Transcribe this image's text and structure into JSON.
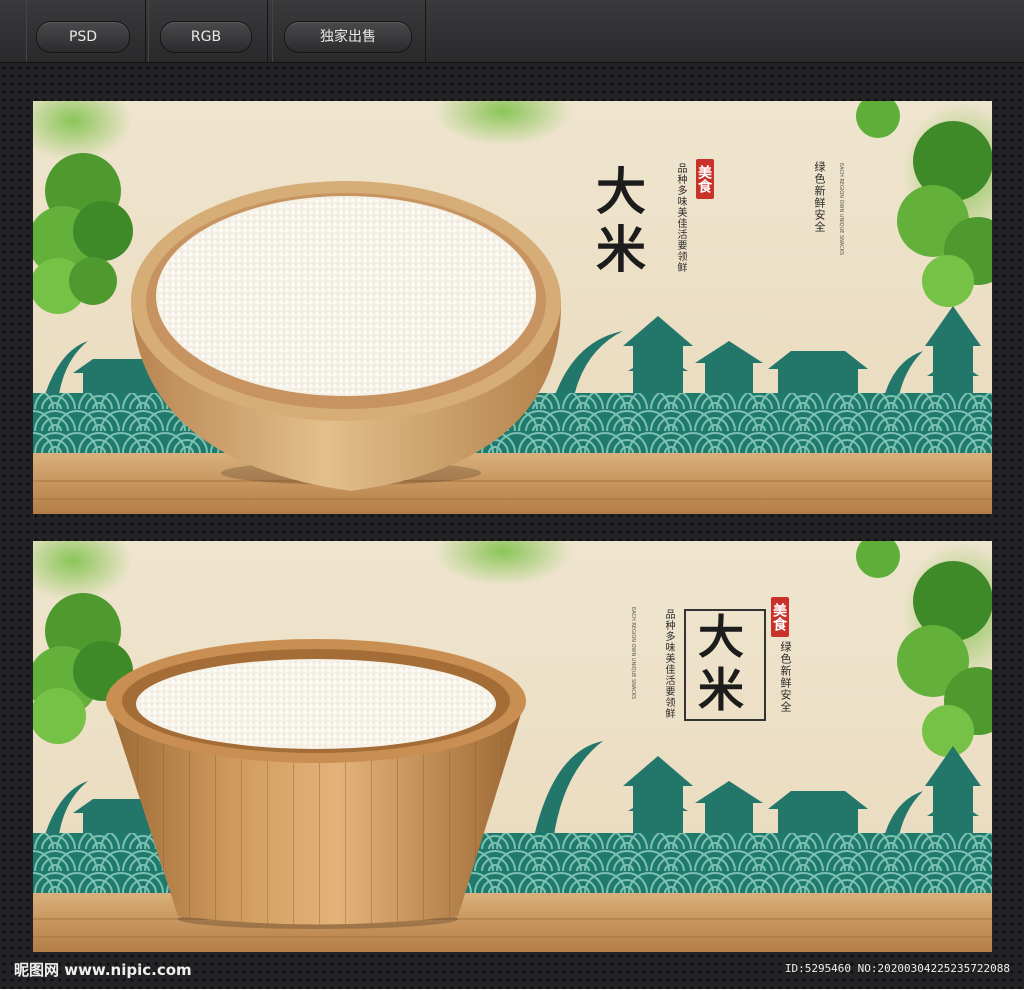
{
  "toolbar": {
    "tags": [
      "PSD",
      "RGB",
      "独家出售"
    ]
  },
  "panel1": {
    "title_chars": [
      "大",
      "米"
    ],
    "slogan_left": "品种多味美佳活要领鲜",
    "seal": "美食",
    "slogan_right": "绿色新鲜安全",
    "small_en": "EACH REGION OWN UNIQUE SNACKS"
  },
  "panel2": {
    "title_chars": [
      "大",
      "米"
    ],
    "slogan_left": "品种多味美佳活要领鲜",
    "seal": "美食",
    "slogan_right": "绿色新鲜安全",
    "small_en": "EACH REGION OWN UNIQUE SNACKS"
  },
  "footer": {
    "logo": "昵图网 www.nipic.com",
    "id": "ID:5295460 NO:20200304225235722088"
  },
  "colors": {
    "paper": "#ece1c8",
    "teal": "#1f7a6c",
    "wood": "#c99a65",
    "seal_red": "#c9322a",
    "tree_green": "#5fae3a"
  }
}
